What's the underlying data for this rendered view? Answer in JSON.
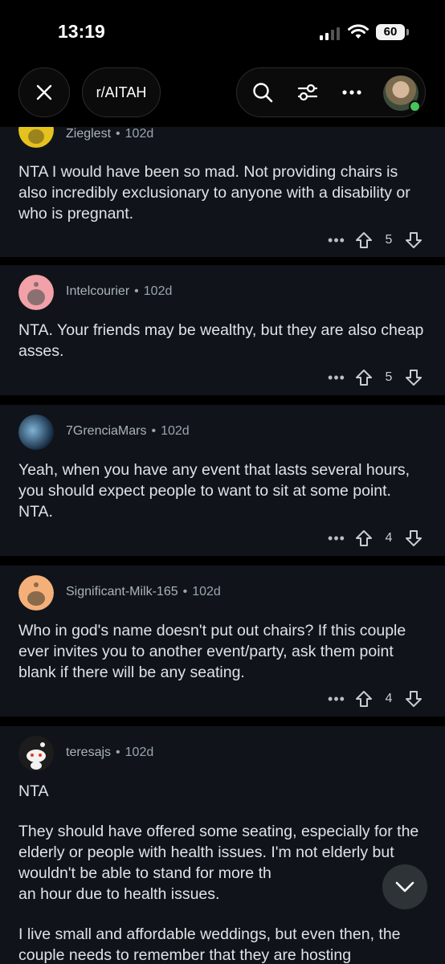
{
  "status_bar": {
    "time": "13:19",
    "battery": "60"
  },
  "nav": {
    "subreddit": "r/AITAH"
  },
  "comments": [
    {
      "user": "Zieglest",
      "age": "102d",
      "body": [
        "NTA I would have been so mad. Not providing chairs is also incredibly exclusionary to anyone with a disability or who is pregnant."
      ],
      "votes": "5",
      "avatar_color": "#e5c21e"
    },
    {
      "user": "Intelcourier",
      "age": "102d",
      "body": [
        "NTA. Your friends may be wealthy, but they are also cheap asses."
      ],
      "votes": "5",
      "avatar_color": "#f3a1a8"
    },
    {
      "user": "7GrenciaMars",
      "age": "102d",
      "body": [
        "Yeah, when you have any event that lasts several hours, you should expect people to want to sit at some point. NTA."
      ],
      "votes": "4",
      "avatar_color": "#2b5c86"
    },
    {
      "user": "Significant-Milk-165",
      "age": "102d",
      "body": [
        "Who in god's name doesn't put out chairs?  If this couple ever invites you to another event/party, ask them point blank if there will be any seating."
      ],
      "votes": "4",
      "avatar_color": "#f5b07a"
    },
    {
      "user": "teresajs",
      "age": "102d",
      "body": [
        "NTA",
        "They should have offered some seating, especially for the elderly or people with health issues.  I'm not elderly but wouldn't be able to stand for more th",
        "an hour due to health issues.",
        "I live small and affordable weddings, but even then, the couple needs to remember that they are hosting"
      ],
      "avatar_color": "#1c1c1c"
    }
  ]
}
